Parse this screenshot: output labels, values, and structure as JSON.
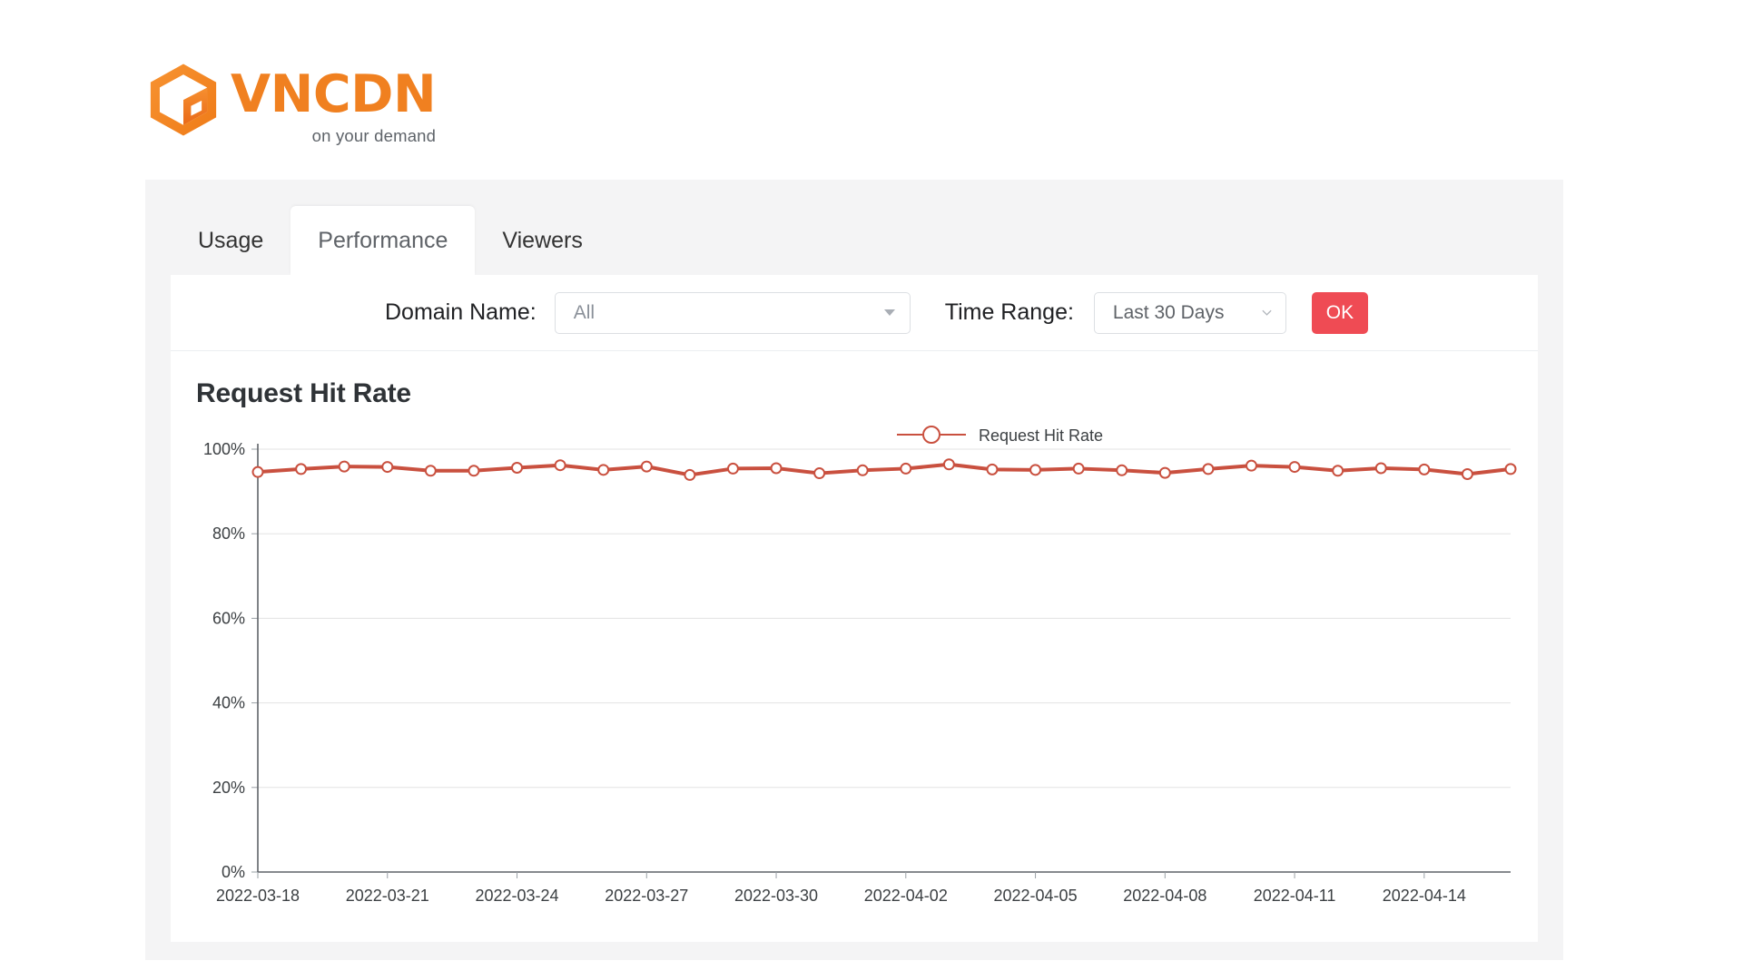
{
  "brand": {
    "name": "VNCDN",
    "tagline": "on your demand",
    "logo_icon": "hexagon-cube-icon",
    "color": "#f08020"
  },
  "tabs": [
    {
      "label": "Usage",
      "active": false
    },
    {
      "label": "Performance",
      "active": true
    },
    {
      "label": "Viewers",
      "active": false
    }
  ],
  "filters": {
    "domain_label": "Domain Name:",
    "domain_value": "All",
    "domain_caret_icon": "caret-down-icon",
    "time_label": "Time Range:",
    "time_value": "Last 30 Days",
    "time_caret_icon": "chevron-down-icon",
    "ok_label": "OK",
    "ok_color": "#ef4b54"
  },
  "chart_data": {
    "type": "line",
    "title": "Request Hit Rate",
    "xlabel": "",
    "ylabel": "",
    "ylim": [
      0,
      100
    ],
    "yticks": [
      0,
      20,
      40,
      60,
      80,
      100
    ],
    "ytick_labels": [
      "0%",
      "20%",
      "40%",
      "60%",
      "80%",
      "100%"
    ],
    "grid": true,
    "legend": [
      "Request Hit Rate"
    ],
    "legend_position": "top-center",
    "series_color": "#c9503f",
    "marker": "open-circle",
    "xtick_labels": [
      "2022-03-18",
      "2022-03-21",
      "2022-03-24",
      "2022-03-27",
      "2022-03-30",
      "2022-04-02",
      "2022-04-05",
      "2022-04-08",
      "2022-04-11",
      "2022-04-14"
    ],
    "x": [
      "2022-03-18",
      "2022-03-19",
      "2022-03-20",
      "2022-03-21",
      "2022-03-22",
      "2022-03-23",
      "2022-03-24",
      "2022-03-25",
      "2022-03-26",
      "2022-03-27",
      "2022-03-28",
      "2022-03-29",
      "2022-03-30",
      "2022-03-31",
      "2022-04-01",
      "2022-04-02",
      "2022-04-03",
      "2022-04-04",
      "2022-04-05",
      "2022-04-06",
      "2022-04-07",
      "2022-04-08",
      "2022-04-09",
      "2022-04-10",
      "2022-04-11",
      "2022-04-12",
      "2022-04-13",
      "2022-04-14",
      "2022-04-15",
      "2022-04-16"
    ],
    "series": [
      {
        "name": "Request Hit Rate",
        "values": [
          94.6,
          95.3,
          95.9,
          95.8,
          94.9,
          94.9,
          95.6,
          96.2,
          95.1,
          95.9,
          93.9,
          95.4,
          95.5,
          94.3,
          95.0,
          95.4,
          96.4,
          95.2,
          95.1,
          95.4,
          95.0,
          94.4,
          95.3,
          96.1,
          95.8,
          94.9,
          95.5,
          95.2,
          94.1,
          95.3
        ]
      }
    ]
  }
}
